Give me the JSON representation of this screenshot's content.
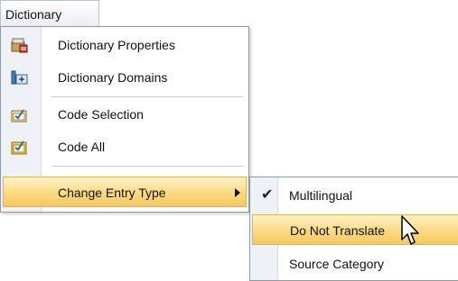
{
  "menubar": {
    "title": "Dictionary"
  },
  "main_menu": {
    "items": [
      {
        "label": "Dictionary Properties",
        "icon": "dictionary-properties-icon"
      },
      {
        "label": "Dictionary Domains",
        "icon": "dictionary-domains-icon"
      },
      {
        "label": "Code Selection",
        "icon": "code-selection-icon"
      },
      {
        "label": "Code All",
        "icon": "code-all-icon"
      },
      {
        "label": "Change Entry Type",
        "icon": "submenu-arrow-icon"
      }
    ]
  },
  "sub_menu": {
    "items": [
      {
        "label": "Multilingual",
        "checked": true
      },
      {
        "label": "Do Not Translate",
        "checked": false
      },
      {
        "label": "Source Category",
        "checked": false
      }
    ]
  },
  "colors": {
    "highlight": "#f9d57a",
    "gutter": "#eef1f5",
    "border": "#8d99a6"
  }
}
